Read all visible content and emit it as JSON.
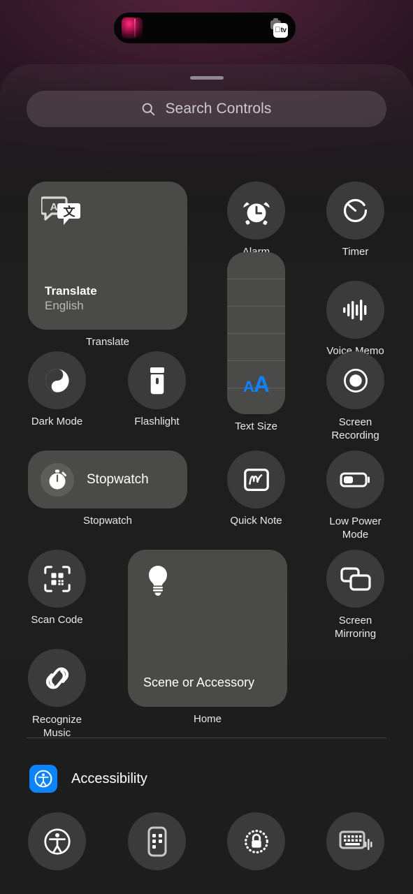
{
  "status": {
    "dynamic_island": {
      "left_icon": "album-art-thumbnail",
      "right_icon": "apple-tv-badge",
      "apple_glyph": "",
      "tv_text": "tv"
    }
  },
  "panel": {
    "grabber": "drag-handle"
  },
  "search": {
    "placeholder": "Search Controls",
    "icon": "search-icon"
  },
  "controls": [
    {
      "id": "translate",
      "kind": "large-tile",
      "label": "Translate",
      "tile_title": "Translate",
      "tile_subtitle": "English",
      "icon": "translate-icon"
    },
    {
      "id": "alarm",
      "kind": "circle",
      "label": "Alarm",
      "icon": "alarm-clock-icon"
    },
    {
      "id": "timer",
      "kind": "circle",
      "label": "Timer",
      "icon": "timer-icon"
    },
    {
      "id": "text-size",
      "kind": "slider",
      "label": "Text Size",
      "icon": "text-size-icon",
      "value_small": "A",
      "value_large": "A",
      "accent": "#0a84ff",
      "segments": 6
    },
    {
      "id": "voice-memo",
      "kind": "circle",
      "label": "Voice Memo",
      "icon": "waveform-icon"
    },
    {
      "id": "dark-mode",
      "kind": "circle",
      "label": "Dark Mode",
      "icon": "dark-mode-icon"
    },
    {
      "id": "flashlight",
      "kind": "circle",
      "label": "Flashlight",
      "icon": "flashlight-icon"
    },
    {
      "id": "screen-recording",
      "kind": "circle",
      "label": "Screen\nRecording",
      "label_line1": "Screen",
      "label_line2": "Recording",
      "icon": "record-icon"
    },
    {
      "id": "stopwatch",
      "kind": "wide-tile",
      "label": "Stopwatch",
      "tile_title": "Stopwatch",
      "icon": "stopwatch-icon"
    },
    {
      "id": "quick-note",
      "kind": "circle",
      "label": "Quick Note",
      "icon": "quick-note-icon"
    },
    {
      "id": "low-power-mode",
      "kind": "circle",
      "label_line1": "Low Power",
      "label_line2": "Mode",
      "label": "Low Power Mode",
      "icon": "battery-icon"
    },
    {
      "id": "scan-code",
      "kind": "circle",
      "label": "Scan Code",
      "icon": "qr-scan-icon"
    },
    {
      "id": "screen-mirroring",
      "kind": "circle",
      "label_line1": "Screen",
      "label_line2": "Mirroring",
      "label": "Screen Mirroring",
      "icon": "screen-mirroring-icon"
    },
    {
      "id": "home",
      "kind": "large-tile",
      "label": "Home",
      "tile_title": "Scene or Accessory",
      "icon": "lightbulb-icon"
    },
    {
      "id": "recognize-music",
      "kind": "circle",
      "label_line1": "Recognize",
      "label_line2": "Music",
      "label": "Recognize Music",
      "icon": "shazam-icon"
    }
  ],
  "accessibility": {
    "title": "Accessibility",
    "badge_icon": "accessibility-badge-icon",
    "badge_color": "#0a84ff",
    "items": [
      {
        "id": "accessibility-shortcuts",
        "icon": "accessibility-person-icon"
      },
      {
        "id": "assistive-touch",
        "icon": "assistive-touch-icon"
      },
      {
        "id": "guided-access",
        "icon": "lock-dotted-icon"
      },
      {
        "id": "live-speech",
        "icon": "keyboard-speech-icon"
      }
    ]
  },
  "colors": {
    "accent_blue": "#0a84ff",
    "circle_bg": "#3b3b3b",
    "tile_bg": "#4a4a48",
    "panel_bg": "#1e1e1e",
    "label_text": "#e9e9e9"
  }
}
